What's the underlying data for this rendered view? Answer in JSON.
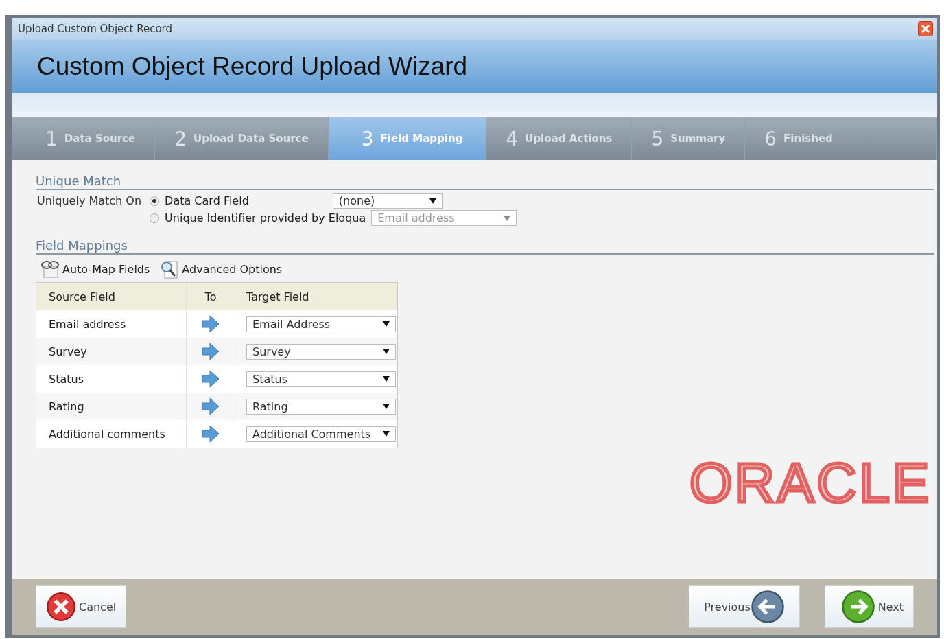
{
  "window": {
    "title": "Upload Custom Object Record"
  },
  "header": {
    "title": "Custom Object Record Upload Wizard"
  },
  "steps": [
    {
      "number": "1",
      "label": "Data Source",
      "selected": false
    },
    {
      "number": "2",
      "label": "Upload Data Source",
      "selected": false
    },
    {
      "number": "3",
      "label": "Field Mapping",
      "selected": true
    },
    {
      "number": "4",
      "label": "Upload Actions",
      "selected": false
    },
    {
      "number": "5",
      "label": "Summary",
      "selected": false
    },
    {
      "number": "6",
      "label": "Finished",
      "selected": false
    }
  ],
  "unique_match": {
    "title": "Unique Match",
    "label": "Uniquely Match On",
    "options": [
      {
        "label": "Data Card Field",
        "selected": true,
        "dropdown": {
          "value": "(none)",
          "disabled": false
        }
      },
      {
        "label": "Unique Identifier provided by Eloqua",
        "selected": false,
        "dropdown": {
          "value": "Email address",
          "disabled": true
        }
      }
    ]
  },
  "field_mappings": {
    "title": "Field Mappings",
    "tools": [
      {
        "label": "Auto-Map Fields",
        "kind": "automap"
      },
      {
        "label": "Advanced Options",
        "kind": "advanced"
      }
    ],
    "columns": [
      "Source Field",
      "To",
      "Target Field"
    ],
    "rows": [
      {
        "source": "Email address",
        "target": "Email Address"
      },
      {
        "source": "Survey",
        "target": "Survey"
      },
      {
        "source": "Status",
        "target": "Status"
      },
      {
        "source": "Rating",
        "target": "Rating"
      },
      {
        "source": "Additional comments",
        "target": "Additional Comments"
      }
    ]
  },
  "logo": {
    "text": "ORACLE"
  },
  "buttons": [
    {
      "label": "Cancel",
      "kind": "cancel"
    },
    {
      "label": "Previous",
      "kind": "previous"
    },
    {
      "label": "Next",
      "kind": "next"
    }
  ]
}
